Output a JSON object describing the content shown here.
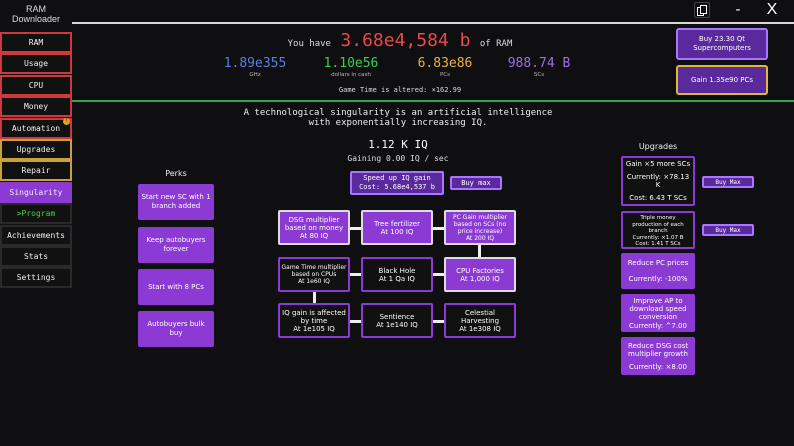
{
  "app": {
    "title_line1": "RAM",
    "title_line2": "Downloader"
  },
  "window": {
    "copy_icon": "copy-icon",
    "minimize": "-",
    "close": "X"
  },
  "sidebar": {
    "items": [
      {
        "label": "RAM"
      },
      {
        "label": "Usage"
      },
      {
        "label": "CPU"
      },
      {
        "label": "Money"
      },
      {
        "label": "Automation",
        "badge": "!"
      },
      {
        "label": "Upgrades"
      },
      {
        "label": "Repair"
      },
      {
        "label": "Singularity"
      },
      {
        "label": ">Program"
      },
      {
        "label": "Achievements"
      },
      {
        "label": "Stats"
      },
      {
        "label": "Settings"
      }
    ]
  },
  "header": {
    "have_prefix": "You have",
    "ram_amount": "3.68e4,584 b",
    "have_suffix": "of RAM",
    "stats": [
      {
        "value": "1.89e355",
        "label": "GHz",
        "color": "#5b7fe0"
      },
      {
        "value": "1.10e56",
        "label": "dollars in cash",
        "color": "#3fcf4f"
      },
      {
        "value": "6.83e86",
        "label": "PCs",
        "color": "#e8b24a"
      },
      {
        "value": "988.74 B",
        "label": "SCs",
        "color": "#9b6fe8"
      }
    ],
    "game_time": "Game Time is altered: ×162.99",
    "buy_super_line1": "Buy 23.30 Qt",
    "buy_super_line2": "Supercomputers",
    "gain_pcs": "Gain 1.35e90 PCs"
  },
  "singularity": {
    "description_line1": "A technological singularity is an artificial intelligence",
    "description_line2": "with exponentially increasing IQ.",
    "iq": "1.12 K IQ",
    "gaining": "Gaining 0.00  IQ / sec",
    "speed_line1": "Speed up IQ gain",
    "speed_line2": "Cost: 5.68e4,537 b",
    "buy_max": "Buy max"
  },
  "perks": {
    "title": "Perks",
    "items": [
      "Start new SC with 1 branch added",
      "Keep autobuyers forever",
      "Start with 8 PCs",
      "Autobuyers bulk buy"
    ]
  },
  "tree": {
    "nodes": [
      {
        "line1": "DSG multiplier based on money",
        "line2": "At 80 IQ"
      },
      {
        "line1": "Tree fertilizer",
        "line2": "At 100 IQ"
      },
      {
        "line1": "PC Gain multiplier based on SCs (no price increase)",
        "line2": "At 200 IQ"
      },
      {
        "line1": "Game Time multiplier based on CPUs",
        "line2": "At 1e60 IQ"
      },
      {
        "line1": "Black Hole",
        "line2": "At 1 Qa IQ"
      },
      {
        "line1": "CPU Factories",
        "line2": "At 1,000 IQ"
      },
      {
        "line1": "IQ gain is affected by time",
        "line2": "At 1e105 IQ"
      },
      {
        "line1": "Sentience",
        "line2": "At 1e140 IQ"
      },
      {
        "line1": "Celestial Harvesting",
        "line2": "At 1e308 IQ"
      }
    ]
  },
  "upgrades": {
    "title": "Upgrades",
    "items": [
      {
        "title": "Gain ×5 more SCs",
        "current": "Currently: ×78.13 K",
        "cost": "Cost: 6.43 T SCs",
        "buy": "Buy Max"
      },
      {
        "title": "Triple money production of each branch",
        "current": "Currently: ×1.07 B",
        "cost": "Cost: 1.41 T SCs",
        "buy": "Buy Max"
      },
      {
        "title": "Reduce PC prices",
        "current": "Currently: -100%"
      },
      {
        "title": "Improve AP to download speed conversion",
        "current": "Currently: ^7.00"
      },
      {
        "title": "Reduce DSG cost multiplier growth",
        "current": "Currently: ×8.00"
      }
    ]
  }
}
